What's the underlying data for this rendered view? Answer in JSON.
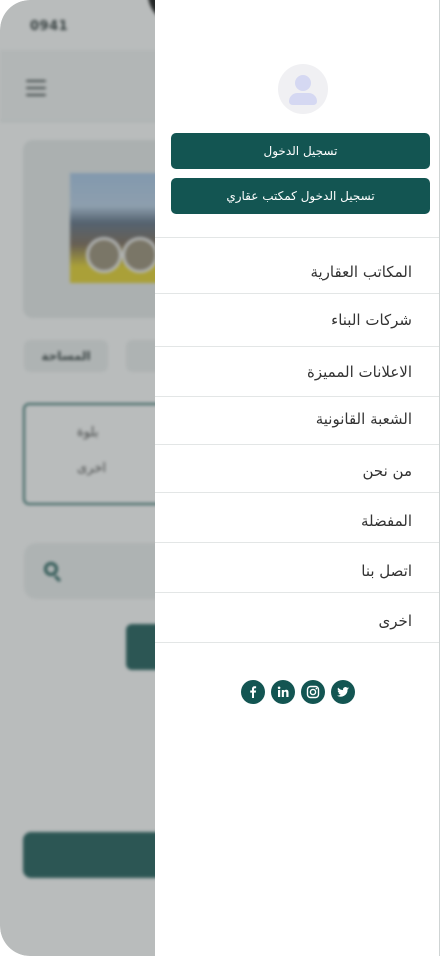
{
  "status_bar": {
    "time": "0941"
  },
  "background": {
    "chip_area_label": "المساحة",
    "box_line1": "بلوة",
    "box_line2": "اخرى"
  },
  "drawer": {
    "login_label": "تسجيل الدخول",
    "login_office_label": "تسجيل الدخول كمكتب عقاري",
    "menu": [
      "المكاتب العقارية",
      "شركات البناء",
      "الاعلانات المميزة",
      "الشعبة القانونية",
      "من نحن",
      "المفضلة",
      "اتصل بنا",
      "اخرى"
    ],
    "social": [
      "facebook-icon",
      "linkedin-icon",
      "instagram-icon",
      "twitter-icon"
    ]
  },
  "colors": {
    "primary": "#135552",
    "avatar_bg": "#f0f0f3",
    "avatar_fg": "#d5d8f2"
  }
}
